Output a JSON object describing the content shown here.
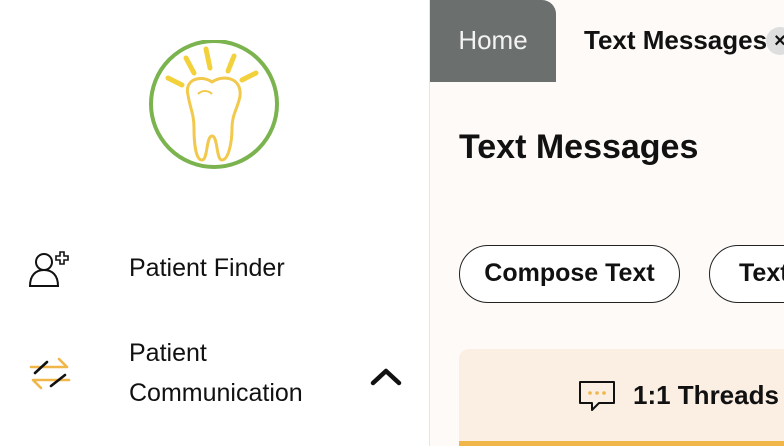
{
  "sidebar": {
    "logo_icon": "tooth-logo-icon",
    "items": [
      {
        "label": "Patient Finder",
        "icon": "patient-add-icon"
      },
      {
        "label_line1": "Patient",
        "label_line2": "Communication",
        "icon": "arrows-exchange-icon",
        "expanded_icon": "chevron-up-icon"
      }
    ]
  },
  "tabs": [
    {
      "label": "Home",
      "active": false
    },
    {
      "label": "Text Messages",
      "active": true,
      "close": "×"
    }
  ],
  "main": {
    "title": "Text Messages",
    "actions": [
      {
        "label": "Compose Text"
      },
      {
        "label": "Text"
      }
    ],
    "threads": {
      "label": "1:1 Threads",
      "icon": "chat-bubble-icon"
    }
  },
  "colors": {
    "tab_inactive_bg": "#6b706e",
    "content_bg": "#fdfaf8",
    "threads_bg": "#fbeee3",
    "accent_orange": "#f0b64a",
    "logo_green": "#7bb34f",
    "logo_yellow": "#f2d13a"
  }
}
